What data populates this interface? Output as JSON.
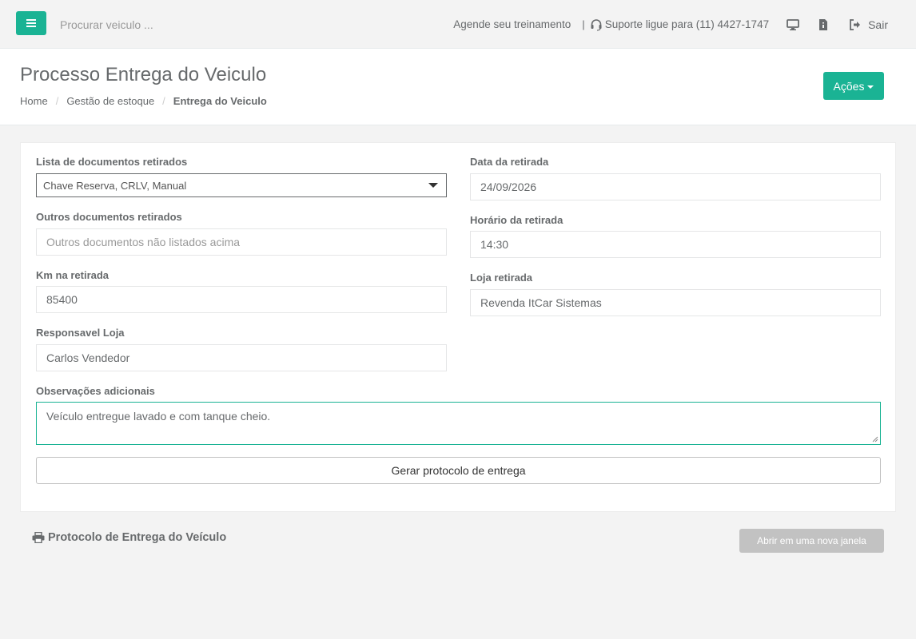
{
  "topbar": {
    "search_placeholder": "Procurar veiculo ...",
    "training_link": "Agende seu treinamento",
    "separator": "|",
    "support_text": "Suporte ligue para (11) 4427-1747",
    "logout_label": "Sair"
  },
  "heading": {
    "title": "Processo Entrega do Veiculo",
    "breadcrumb": [
      "Home",
      "Gestão de estoque",
      "Entrega do Veiculo"
    ],
    "actions_label": "Ações"
  },
  "form": {
    "docs_label": "Lista de documentos retirados",
    "docs_value": "Chave Reserva, CRLV, Manual",
    "other_docs_label": "Outros documentos retirados",
    "other_docs_placeholder": "Outros documentos não listados acima",
    "km_label": "Km na retirada",
    "km_value": "85400",
    "responsible_label": "Responsavel Loja",
    "responsible_value": "Carlos Vendedor",
    "date_label": "Data da retirada",
    "date_value": "24/09/2026",
    "time_label": "Horário da retirada",
    "time_value": "14:30",
    "store_label": "Loja retirada",
    "store_value": "Revenda ItCar Sistemas",
    "notes_label": "Observações adicionais",
    "notes_value": "Veículo entregue lavado e com tanque cheio.",
    "generate_button": "Gerar protocolo de entrega"
  },
  "protocol": {
    "title": "Protocolo de Entrega do Veículo",
    "open_button": "Abrir em uma nova janela"
  },
  "colors": {
    "accent": "#1ab394",
    "text": "#676a6c",
    "disabled_button": "#c2c2c2"
  },
  "icons": [
    "menu-icon",
    "headset-icon",
    "monitor-icon",
    "document-icon",
    "sign-out-icon",
    "caret-down-icon",
    "print-icon"
  ]
}
